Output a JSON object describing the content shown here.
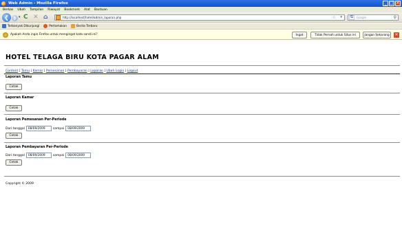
{
  "window": {
    "title": "Web Admin - Mozilla Firefox",
    "controls": [
      "_",
      "□",
      "✕"
    ]
  },
  "menubar": [
    "Berkas",
    "Ubah",
    "Tampilan",
    "Riwayat",
    "Bookmark",
    "Alat",
    "Bantuan"
  ],
  "toolbar": {
    "back": "❮",
    "forward": "❯",
    "dropdown": "▾",
    "reload": "C",
    "stop": "✕",
    "home": "⌂",
    "url": "http://localhost/hotel/admin_laporan.php",
    "star": "☆",
    "url_dropdown": "▾",
    "search_engine": "G",
    "search_placeholder": "Google",
    "search_go": "⚲"
  },
  "bookmarks": [
    {
      "label": "Terbanyak Dikunjungi",
      "icon": "bookmark-star-icon",
      "color": "#3b6fc6"
    },
    {
      "label": "Pertamakan",
      "icon": "firefox-icon",
      "color": "#e0591a"
    },
    {
      "label": "Berita Terbaru",
      "icon": "rss-icon",
      "color": "#f0a030"
    }
  ],
  "notification": {
    "text": "Apakah Anda ingin Firefox untuk mengingat kata sandi ini?",
    "remember_label": "Ingat",
    "never_label": "Tidak Pernah untuk Situs ini",
    "not_now_label": "Jangan Sekarang",
    "close": "✕"
  },
  "page": {
    "site_title": "HOTEL TELAGA BIRU KOTA PAGAR ALAM",
    "nav": [
      "Content",
      "Tamu",
      "Kamar",
      "Pemesanan",
      "Pembayaran",
      "Laporan",
      "Ubah Login",
      "Logout"
    ],
    "nav_sep": " | ",
    "sections": {
      "tamu": {
        "title": "Laporan Tamu",
        "button": "Cetak"
      },
      "kamar": {
        "title": "Laporan Kamar",
        "button": "Cetak"
      },
      "pemesanan": {
        "title": "Laporan Pemesanan Per-Periode",
        "from_label": "Dari tanggal",
        "from_value": "08/09/2009",
        "to_label": "sampai",
        "to_value": "08/09/2009",
        "button": "Cetak"
      },
      "pembayaran": {
        "title": "Laporan Pembayaran Per-Periode",
        "from_label": "Dari tanggal",
        "from_value": "08/09/2009",
        "to_label": "sampai",
        "to_value": "08/09/2009",
        "button": "Cetak"
      }
    },
    "footer": "Copyright © 2009"
  },
  "colors": {
    "titlebar": "#1553c8",
    "link": "#1a2fc9",
    "notification_bg": "#ffffe1"
  }
}
